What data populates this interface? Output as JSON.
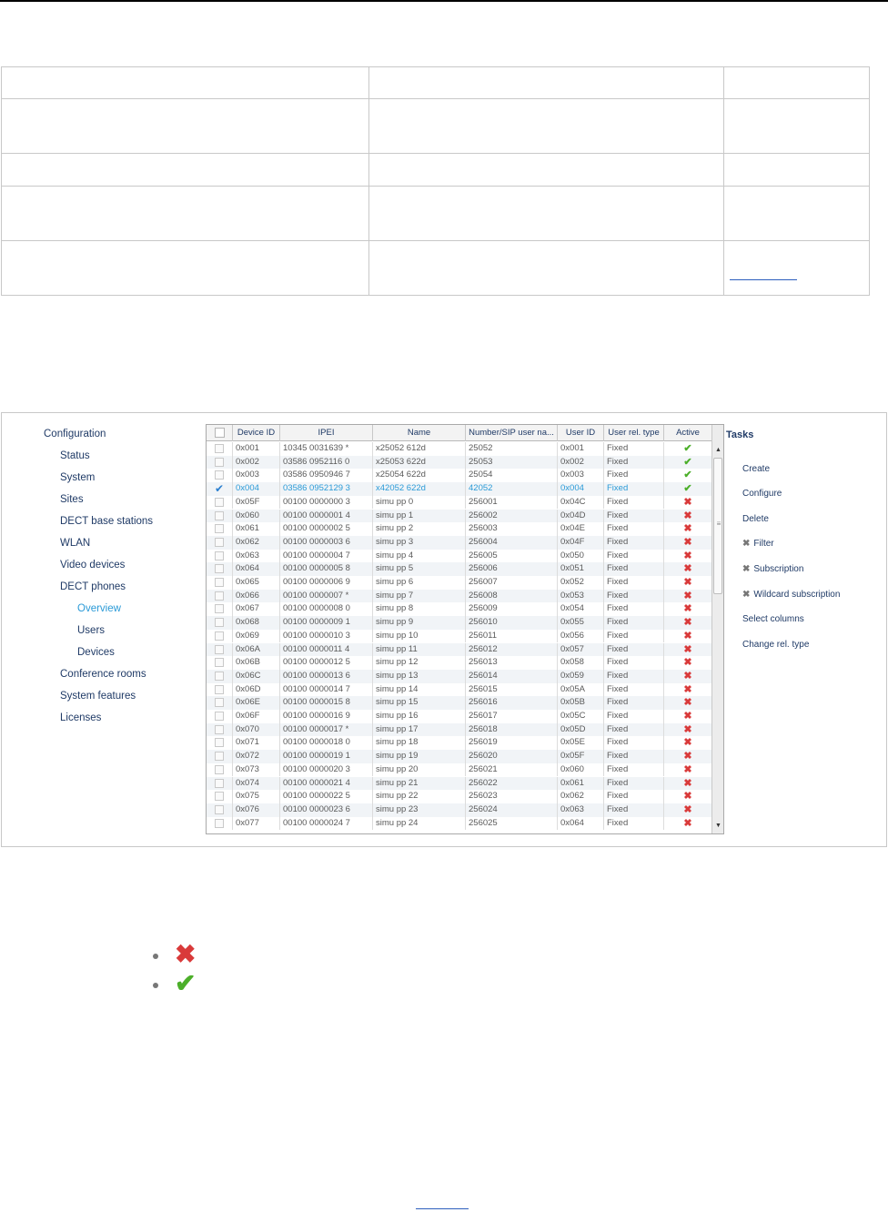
{
  "navigation": {
    "items": [
      {
        "label": "Configuration",
        "level": 0,
        "active": false
      },
      {
        "label": "Status",
        "level": 1,
        "active": false
      },
      {
        "label": "System",
        "level": 1,
        "active": false
      },
      {
        "label": "Sites",
        "level": 1,
        "active": false
      },
      {
        "label": "DECT base stations",
        "level": 1,
        "active": false
      },
      {
        "label": "WLAN",
        "level": 1,
        "active": false
      },
      {
        "label": "Video devices",
        "level": 1,
        "active": false
      },
      {
        "label": "DECT phones",
        "level": 1,
        "active": false
      },
      {
        "label": "Overview",
        "level": 2,
        "active": true
      },
      {
        "label": "Users",
        "level": 2,
        "active": false
      },
      {
        "label": "Devices",
        "level": 2,
        "active": false
      },
      {
        "label": "Conference rooms",
        "level": 1,
        "active": false
      },
      {
        "label": "System features",
        "level": 1,
        "active": false
      },
      {
        "label": "Licenses",
        "level": 1,
        "active": false
      }
    ]
  },
  "grid": {
    "columns": [
      "",
      "Device ID",
      "IPEI",
      "Name",
      "Number/SIP user na...",
      "User ID",
      "User rel. type",
      "Active"
    ],
    "rows": [
      {
        "device_id": "0x001",
        "ipei": "10345 0031639 *",
        "name": "x25052 612d",
        "number": "25052",
        "user_id": "0x001",
        "rel_type": "Fixed",
        "active": true,
        "selected": false
      },
      {
        "device_id": "0x002",
        "ipei": "03586 0952116 0",
        "name": "x25053 622d",
        "number": "25053",
        "user_id": "0x002",
        "rel_type": "Fixed",
        "active": true,
        "selected": false
      },
      {
        "device_id": "0x003",
        "ipei": "03586 0950946 7",
        "name": "x25054 622d",
        "number": "25054",
        "user_id": "0x003",
        "rel_type": "Fixed",
        "active": true,
        "selected": false
      },
      {
        "device_id": "0x004",
        "ipei": "03586 0952129 3",
        "name": "x42052 622d",
        "number": "42052",
        "user_id": "0x004",
        "rel_type": "Fixed",
        "active": true,
        "selected": true
      },
      {
        "device_id": "0x05F",
        "ipei": "00100 0000000 3",
        "name": "simu pp 0",
        "number": "256001",
        "user_id": "0x04C",
        "rel_type": "Fixed",
        "active": false,
        "selected": false
      },
      {
        "device_id": "0x060",
        "ipei": "00100 0000001 4",
        "name": "simu pp 1",
        "number": "256002",
        "user_id": "0x04D",
        "rel_type": "Fixed",
        "active": false,
        "selected": false
      },
      {
        "device_id": "0x061",
        "ipei": "00100 0000002 5",
        "name": "simu pp 2",
        "number": "256003",
        "user_id": "0x04E",
        "rel_type": "Fixed",
        "active": false,
        "selected": false
      },
      {
        "device_id": "0x062",
        "ipei": "00100 0000003 6",
        "name": "simu pp 3",
        "number": "256004",
        "user_id": "0x04F",
        "rel_type": "Fixed",
        "active": false,
        "selected": false
      },
      {
        "device_id": "0x063",
        "ipei": "00100 0000004 7",
        "name": "simu pp 4",
        "number": "256005",
        "user_id": "0x050",
        "rel_type": "Fixed",
        "active": false,
        "selected": false
      },
      {
        "device_id": "0x064",
        "ipei": "00100 0000005 8",
        "name": "simu pp 5",
        "number": "256006",
        "user_id": "0x051",
        "rel_type": "Fixed",
        "active": false,
        "selected": false
      },
      {
        "device_id": "0x065",
        "ipei": "00100 0000006 9",
        "name": "simu pp 6",
        "number": "256007",
        "user_id": "0x052",
        "rel_type": "Fixed",
        "active": false,
        "selected": false
      },
      {
        "device_id": "0x066",
        "ipei": "00100 0000007 *",
        "name": "simu pp 7",
        "number": "256008",
        "user_id": "0x053",
        "rel_type": "Fixed",
        "active": false,
        "selected": false
      },
      {
        "device_id": "0x067",
        "ipei": "00100 0000008 0",
        "name": "simu pp 8",
        "number": "256009",
        "user_id": "0x054",
        "rel_type": "Fixed",
        "active": false,
        "selected": false
      },
      {
        "device_id": "0x068",
        "ipei": "00100 0000009 1",
        "name": "simu pp 9",
        "number": "256010",
        "user_id": "0x055",
        "rel_type": "Fixed",
        "active": false,
        "selected": false
      },
      {
        "device_id": "0x069",
        "ipei": "00100 0000010 3",
        "name": "simu pp 10",
        "number": "256011",
        "user_id": "0x056",
        "rel_type": "Fixed",
        "active": false,
        "selected": false
      },
      {
        "device_id": "0x06A",
        "ipei": "00100 0000011 4",
        "name": "simu pp 11",
        "number": "256012",
        "user_id": "0x057",
        "rel_type": "Fixed",
        "active": false,
        "selected": false
      },
      {
        "device_id": "0x06B",
        "ipei": "00100 0000012 5",
        "name": "simu pp 12",
        "number": "256013",
        "user_id": "0x058",
        "rel_type": "Fixed",
        "active": false,
        "selected": false
      },
      {
        "device_id": "0x06C",
        "ipei": "00100 0000013 6",
        "name": "simu pp 13",
        "number": "256014",
        "user_id": "0x059",
        "rel_type": "Fixed",
        "active": false,
        "selected": false
      },
      {
        "device_id": "0x06D",
        "ipei": "00100 0000014 7",
        "name": "simu pp 14",
        "number": "256015",
        "user_id": "0x05A",
        "rel_type": "Fixed",
        "active": false,
        "selected": false
      },
      {
        "device_id": "0x06E",
        "ipei": "00100 0000015 8",
        "name": "simu pp 15",
        "number": "256016",
        "user_id": "0x05B",
        "rel_type": "Fixed",
        "active": false,
        "selected": false
      },
      {
        "device_id": "0x06F",
        "ipei": "00100 0000016 9",
        "name": "simu pp 16",
        "number": "256017",
        "user_id": "0x05C",
        "rel_type": "Fixed",
        "active": false,
        "selected": false
      },
      {
        "device_id": "0x070",
        "ipei": "00100 0000017 *",
        "name": "simu pp 17",
        "number": "256018",
        "user_id": "0x05D",
        "rel_type": "Fixed",
        "active": false,
        "selected": false
      },
      {
        "device_id": "0x071",
        "ipei": "00100 0000018 0",
        "name": "simu pp 18",
        "number": "256019",
        "user_id": "0x05E",
        "rel_type": "Fixed",
        "active": false,
        "selected": false
      },
      {
        "device_id": "0x072",
        "ipei": "00100 0000019 1",
        "name": "simu pp 19",
        "number": "256020",
        "user_id": "0x05F",
        "rel_type": "Fixed",
        "active": false,
        "selected": false
      },
      {
        "device_id": "0x073",
        "ipei": "00100 0000020 3",
        "name": "simu pp 20",
        "number": "256021",
        "user_id": "0x060",
        "rel_type": "Fixed",
        "active": false,
        "selected": false
      },
      {
        "device_id": "0x074",
        "ipei": "00100 0000021 4",
        "name": "simu pp 21",
        "number": "256022",
        "user_id": "0x061",
        "rel_type": "Fixed",
        "active": false,
        "selected": false
      },
      {
        "device_id": "0x075",
        "ipei": "00100 0000022 5",
        "name": "simu pp 22",
        "number": "256023",
        "user_id": "0x062",
        "rel_type": "Fixed",
        "active": false,
        "selected": false
      },
      {
        "device_id": "0x076",
        "ipei": "00100 0000023 6",
        "name": "simu pp 23",
        "number": "256024",
        "user_id": "0x063",
        "rel_type": "Fixed",
        "active": false,
        "selected": false
      },
      {
        "device_id": "0x077",
        "ipei": "00100 0000024 7",
        "name": "simu pp 24",
        "number": "256025",
        "user_id": "0x064",
        "rel_type": "Fixed",
        "active": false,
        "selected": false
      }
    ]
  },
  "tasks": {
    "title": "Tasks",
    "items": [
      {
        "label": "Create",
        "disabled": false
      },
      {
        "label": "Configure",
        "disabled": false
      },
      {
        "label": "Delete",
        "disabled": false
      },
      {
        "label": "Filter",
        "disabled": true
      },
      {
        "label": "Subscription",
        "disabled": true
      },
      {
        "label": "Wildcard subscription",
        "disabled": true
      },
      {
        "label": "Select columns",
        "disabled": false
      },
      {
        "label": "Change rel. type",
        "disabled": false
      }
    ]
  },
  "icons": {
    "active": "check-icon",
    "inactive": "cross-icon",
    "selected": "checkmark-icon"
  },
  "colors": {
    "active_green": "#4caf2a",
    "inactive_red": "#d93a3a",
    "selection_blue": "#2a9ad7",
    "link_navy": "#1f3a66"
  }
}
